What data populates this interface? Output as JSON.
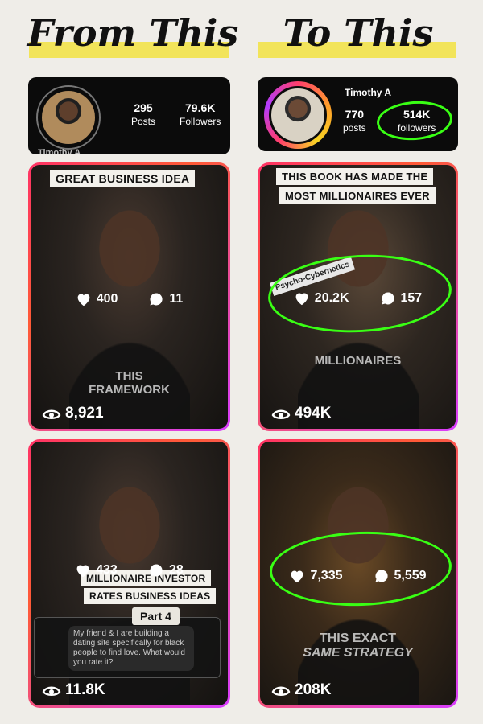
{
  "headings": {
    "left": "From This",
    "right": "To This"
  },
  "before": {
    "profile": {
      "posts_count": "295",
      "posts_label": "Posts",
      "followers_count": "79.6K",
      "followers_label": "Followers",
      "name_cut": "Timothy A"
    },
    "posts": [
      {
        "caption_top": "GREAT BUSINESS IDEA",
        "overlay_lines": [
          "THIS",
          "FRAMEWORK"
        ],
        "likes": "400",
        "comments": "11",
        "views": "8,921"
      },
      {
        "caption_lines": [
          "MILLIONAIRE INVESTOR",
          "RATES BUSINESS IDEAS"
        ],
        "part_label": "Part 4",
        "dm_text": "My friend & I are building a dating site specifically for black people to find love. What would you rate it?",
        "likes": "433",
        "comments": "28",
        "views": "11.8K"
      }
    ]
  },
  "after": {
    "profile": {
      "name": "Timothy A",
      "posts_count": "770",
      "posts_label": "posts",
      "followers_count": "514K",
      "followers_label": "followers"
    },
    "posts": [
      {
        "caption_lines": [
          "THIS BOOK HAS MADE THE",
          "MOST MILLIONAIRES EVER"
        ],
        "overlay_lines": [
          "MILLIONAIRES"
        ],
        "book_text": "Psycho-Cybernetics",
        "likes": "20.2K",
        "comments": "157",
        "views": "494K"
      },
      {
        "overlay_lines": [
          "THIS EXACT",
          "SAME STRATEGY"
        ],
        "likes": "7,335",
        "comments": "5,559",
        "views": "208K"
      }
    ]
  },
  "colors": {
    "background": "#efede8",
    "highlight": "#f2e45a",
    "annotation": "#39ff14",
    "card_border_start": "#ff3366",
    "card_border_end": "#d83cff"
  },
  "icons": [
    "heart-icon",
    "comment-icon",
    "eye-icon"
  ]
}
